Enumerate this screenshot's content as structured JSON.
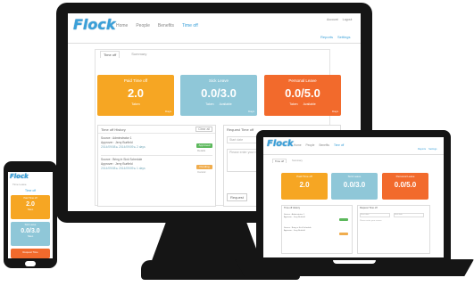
{
  "app": {
    "logo": "Flock",
    "nav": [
      "Home",
      "People",
      "Benefits",
      "Time off"
    ],
    "top_right_links": [
      "Account",
      "Logout"
    ],
    "sub_links": [
      "Reports",
      "Settings"
    ]
  },
  "tabs": [
    "Time off",
    "Summary"
  ],
  "cards": [
    {
      "title": "Paid Time off",
      "value": "2.0",
      "sub1": "Taken",
      "sub2": "",
      "corner": "Days",
      "color": "#f6a623"
    },
    {
      "title": "Sick Leave",
      "value": "0.0/3.0",
      "sub1": "Taken",
      "sub2": "Available",
      "corner": "Days",
      "color": "#8fc7d8"
    },
    {
      "title": "Personal Leave",
      "value": "0.0/5.0",
      "sub1": "Taken",
      "sub2": "Available",
      "corner": "Days",
      "color": "#f26a2c"
    }
  ],
  "history": {
    "title": "Time off History",
    "button": "Clear all",
    "entries": [
      {
        "line1": "Source : Adminstrator 1",
        "line2": "Approver : Jerry Burfield",
        "dates": "2014/09/08 ▸ 2014/09/09 ▸ 2 days",
        "status": "Approved",
        "status_color": "green",
        "note": "Details"
      },
      {
        "line1": "Source : Bring in Sick Schedule",
        "line2": "Approver : Jerry Burfield",
        "dates": "2014/09/08 ▸ 2014/09/09 ▸ 1 days",
        "status": "Pending",
        "status_color": "orange",
        "note": "Cancel"
      }
    ]
  },
  "request": {
    "title": "Request Time off",
    "start_placeholder": "Start date",
    "end_placeholder": "End date",
    "reason_placeholder": "Please enter your reason",
    "button": "Request"
  },
  "colors": {
    "accent": "#3aa0d9",
    "orange": "#f6a623",
    "blue": "#8fc7d8",
    "deep_orange": "#f26a2c",
    "device": "#151515"
  },
  "phone": {
    "label": "Time off",
    "section": "Time Leave",
    "button": "Request Time"
  }
}
